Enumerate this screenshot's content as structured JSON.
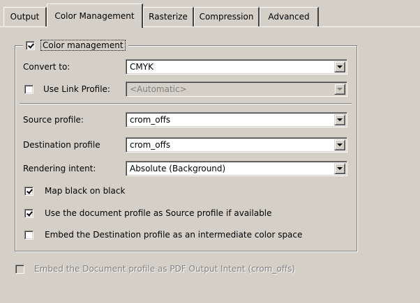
{
  "tabs": [
    {
      "label": "Output"
    },
    {
      "label": "Color Management"
    },
    {
      "label": "Rasterize"
    },
    {
      "label": "Compression"
    },
    {
      "label": "Advanced"
    }
  ],
  "group": {
    "label": "Color management",
    "checked": true
  },
  "convert_to": {
    "label": "Convert to:",
    "value": "CMYK"
  },
  "use_link_profile": {
    "label": "Use Link Profile:",
    "checked": false,
    "value": "<Automatic>"
  },
  "source_profile": {
    "label": "Source profile:",
    "value": "crom_offs"
  },
  "destination_profile": {
    "label": "Destination profile",
    "value": "crom_offs"
  },
  "rendering_intent": {
    "label": "Rendering intent:",
    "value": "Absolute (Background)"
  },
  "options": {
    "map_black": {
      "label": "Map black on black",
      "checked": true
    },
    "use_document_profile": {
      "label": "Use the document profile as Source profile if available",
      "checked": true
    },
    "embed_destination": {
      "label": "Embed the Destination profile as an intermediate color space",
      "checked": false
    }
  },
  "embed_output_intent": {
    "label": "Embed the Document profile as PDF Output Intent (crom_offs)",
    "checked": false
  }
}
